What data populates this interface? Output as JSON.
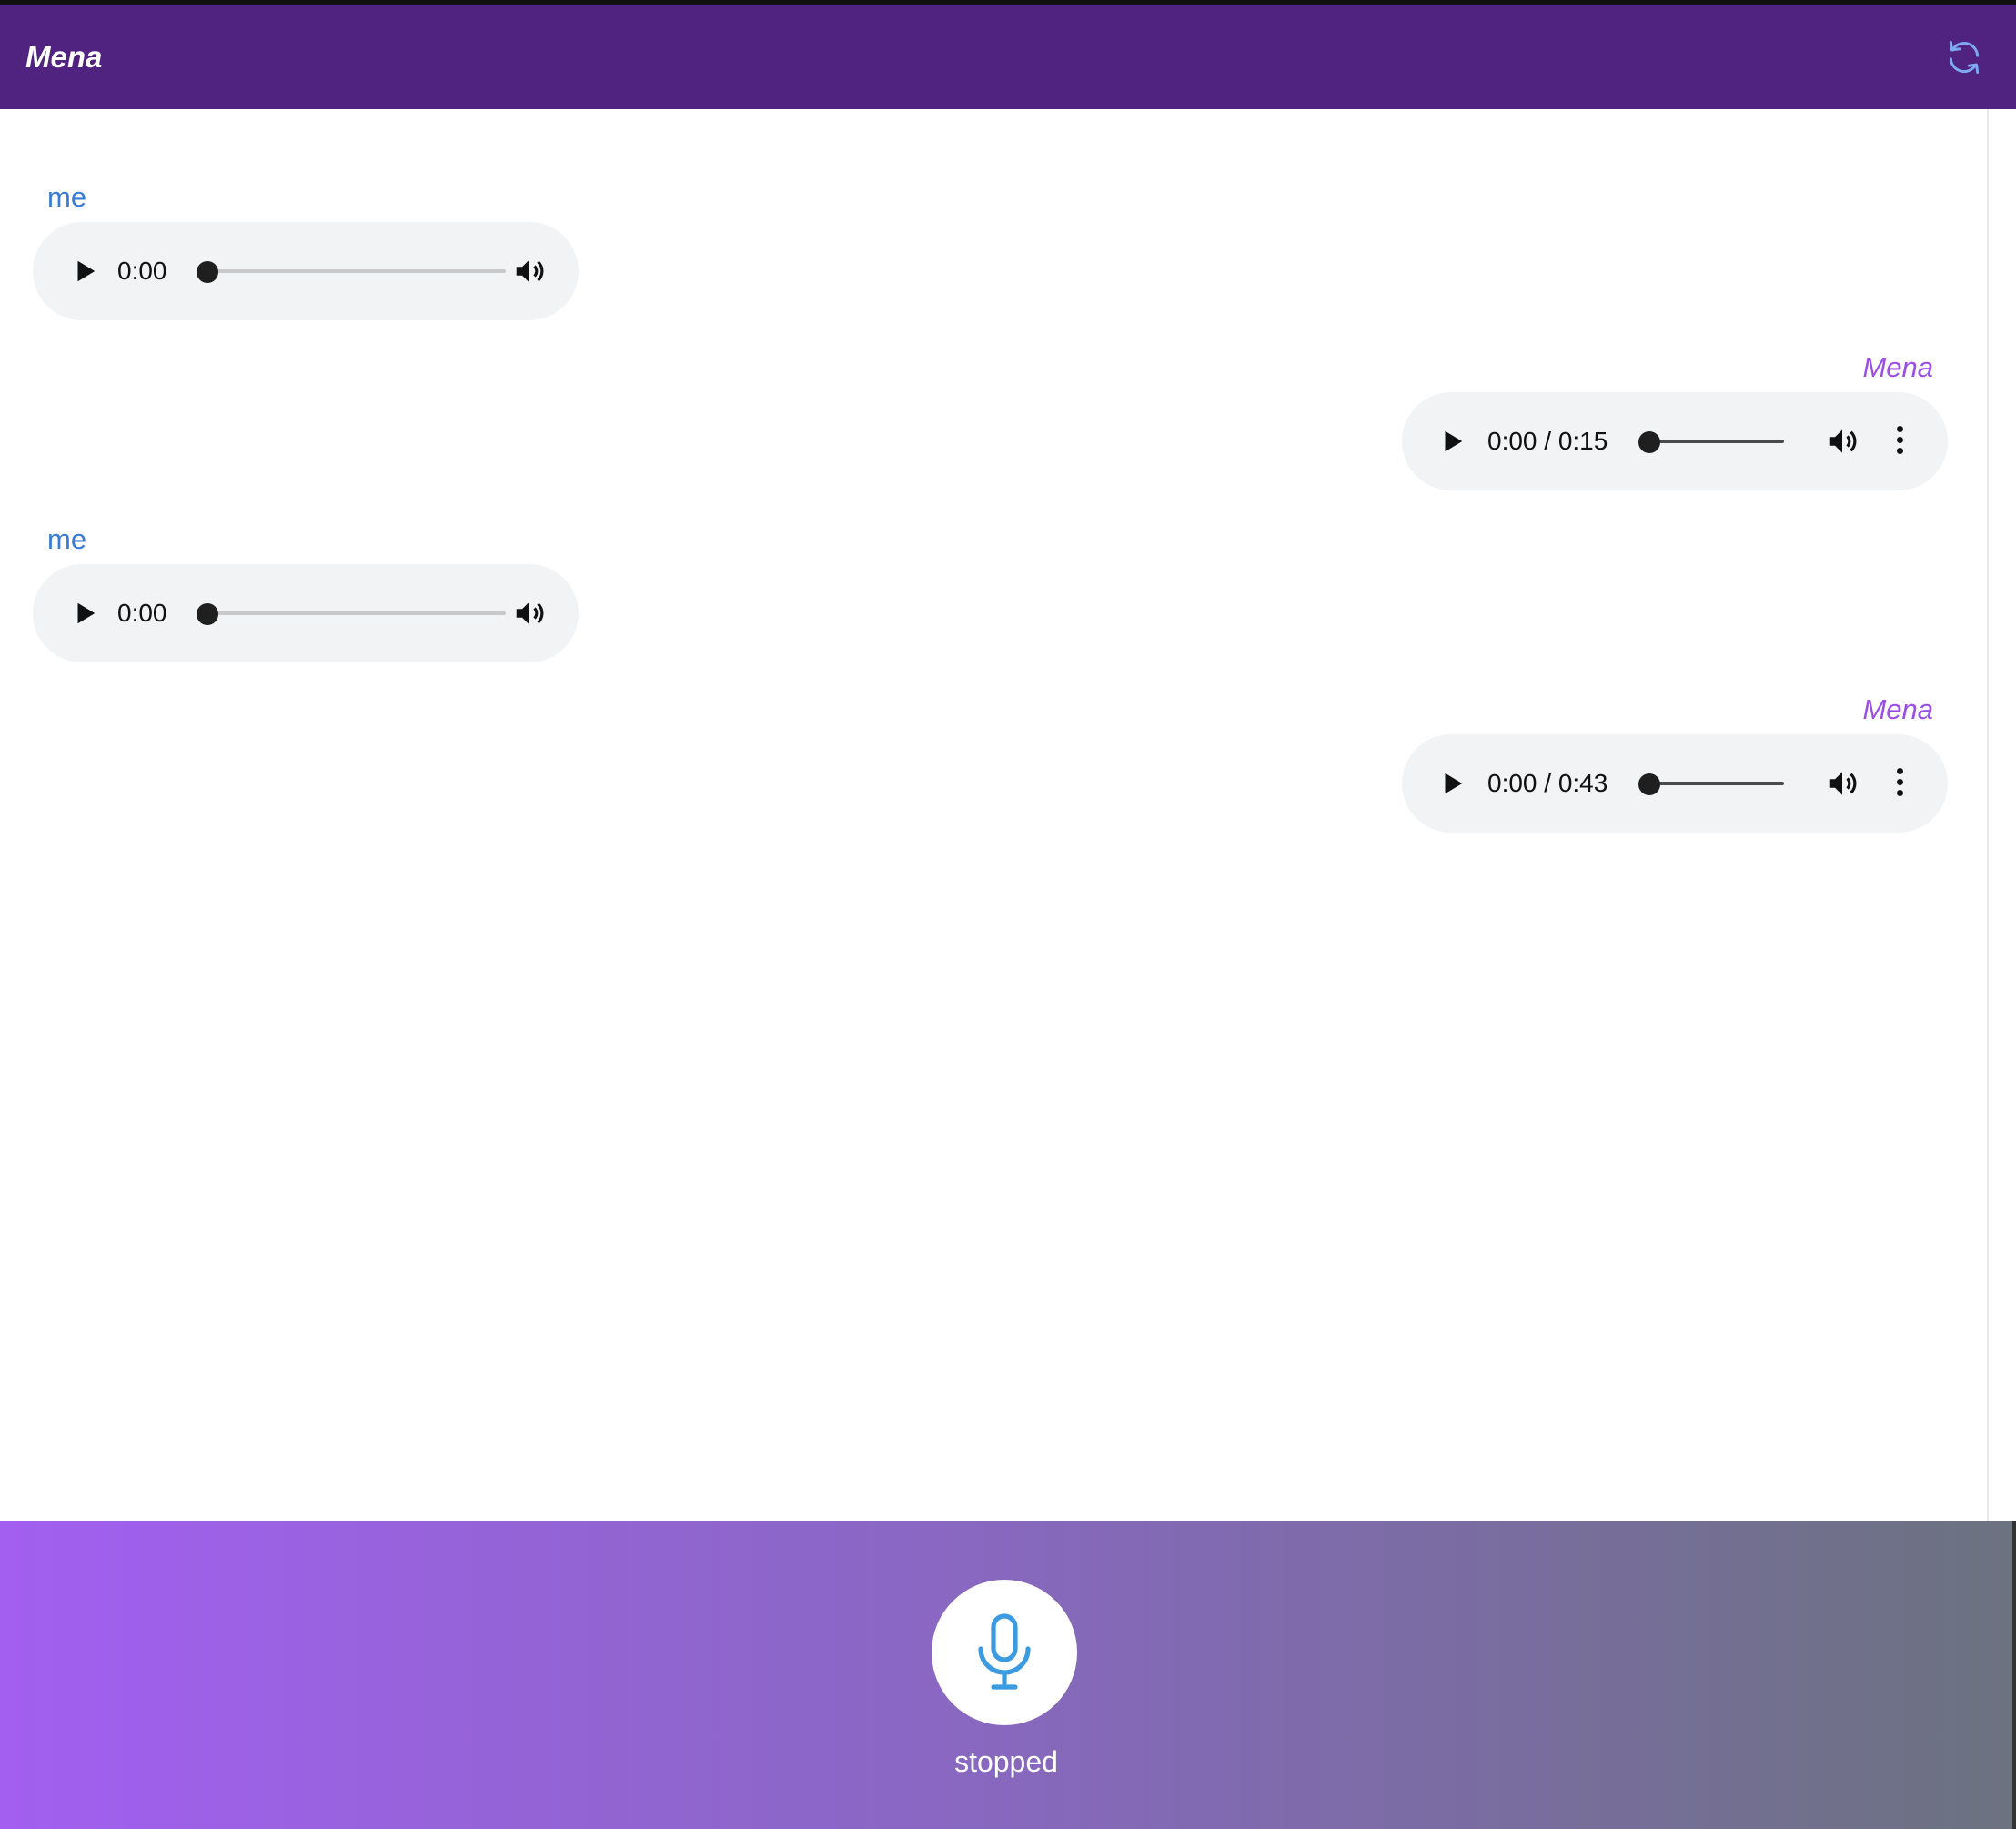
{
  "header": {
    "title": "Mena",
    "refresh_icon": "refresh-icon"
  },
  "messages": [
    {
      "sender": "me",
      "time": "0:00",
      "type": "user"
    },
    {
      "sender": "Mena",
      "time": "0:00 / 0:15",
      "type": "bot"
    },
    {
      "sender": "me",
      "time": "0:00",
      "type": "user"
    },
    {
      "sender": "Mena",
      "time": "0:00 / 0:43",
      "type": "bot"
    }
  ],
  "footer": {
    "mic_icon": "microphone-icon",
    "status": "stopped"
  },
  "colors": {
    "header_bg": "#4f237f",
    "me_label": "#3a7bd5",
    "bot_label": "#9b4de8",
    "player_bg": "#f1f3f4",
    "mic_icon": "#3b9be0"
  }
}
